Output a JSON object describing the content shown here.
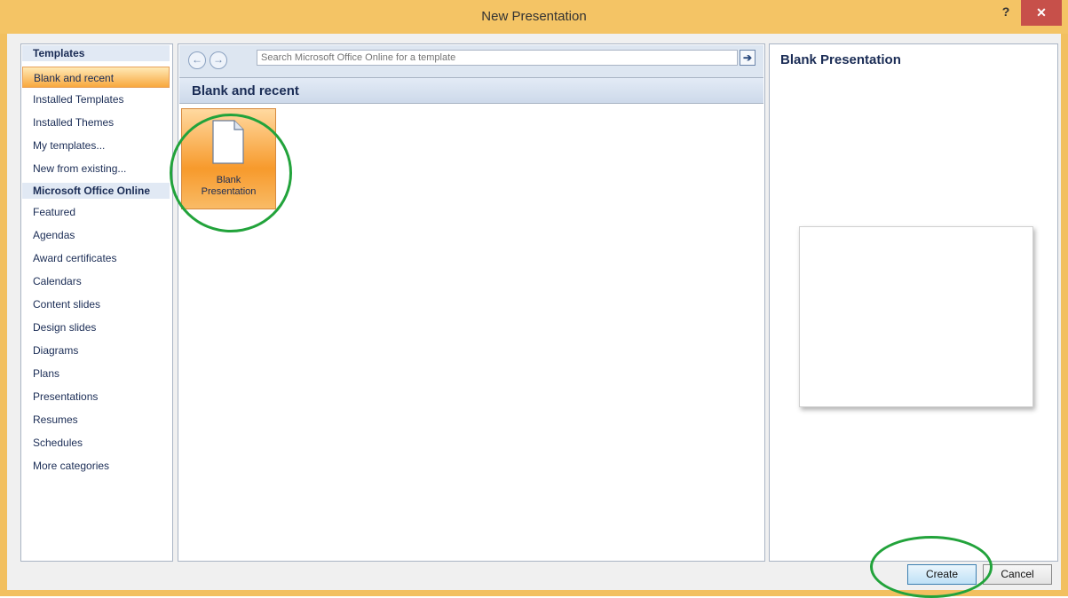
{
  "window": {
    "title": "New Presentation",
    "help_label": "?",
    "close_label": "✕"
  },
  "left_panel": {
    "header_templates": "Templates",
    "items_top": [
      {
        "label": "Blank and recent",
        "selected": true
      },
      {
        "label": "Installed Templates"
      },
      {
        "label": "Installed Themes"
      },
      {
        "label": "My templates..."
      },
      {
        "label": "New from existing..."
      }
    ],
    "header_online": "Microsoft Office Online",
    "items_online": [
      {
        "label": "Featured"
      },
      {
        "label": "Agendas"
      },
      {
        "label": "Award certificates"
      },
      {
        "label": "Calendars"
      },
      {
        "label": "Content slides"
      },
      {
        "label": "Design slides"
      },
      {
        "label": "Diagrams"
      },
      {
        "label": "Plans"
      },
      {
        "label": "Presentations"
      },
      {
        "label": "Resumes"
      },
      {
        "label": "Schedules"
      },
      {
        "label": "More categories"
      }
    ]
  },
  "center": {
    "search_placeholder": "Search Microsoft Office Online for a template",
    "back_icon": "back-arrow-icon",
    "forward_icon": "forward-arrow-icon",
    "heading": "Blank and recent",
    "tile_label_line1": "Blank",
    "tile_label_line2": "Presentation"
  },
  "right": {
    "title": "Blank Presentation"
  },
  "buttons": {
    "create": "Create",
    "cancel": "Cancel"
  },
  "colors": {
    "accent_orange": "#f79a2c",
    "highlight_green": "#22a33b",
    "title_bar": "#f4c465"
  }
}
